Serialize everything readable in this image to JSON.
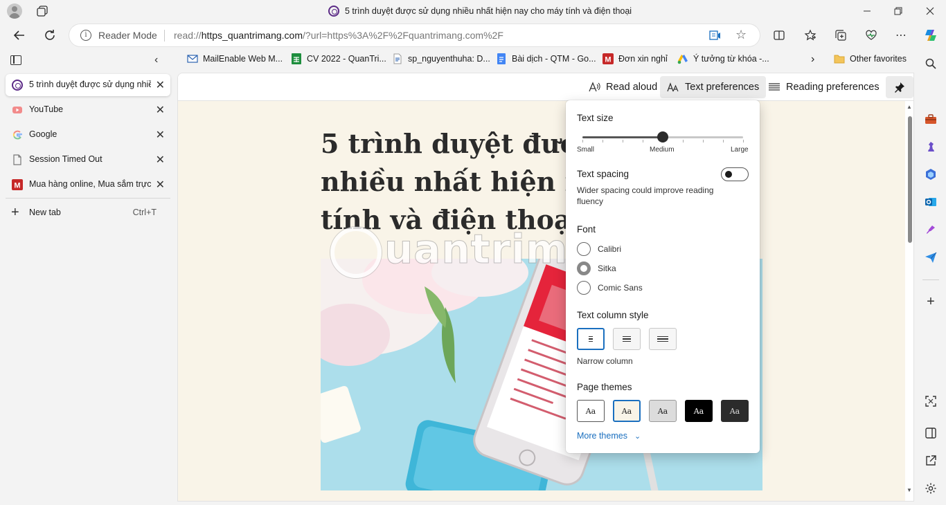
{
  "window": {
    "title": "5 trình duyệt được sử dụng nhiều nhất hiện nay cho máy tính và điện thoại",
    "minimize_icon": "minimize-icon",
    "maximize_icon": "restore-icon",
    "close_icon": "close-icon"
  },
  "address_bar": {
    "mode_label": "Reader Mode",
    "url_prefix": "read://",
    "url_host": "https_quantrimang.com",
    "url_rest": "/?url=https%3A%2F%2Fquantrimang.com%2F"
  },
  "bookmarks": [
    {
      "label": "MailEnable Web M...",
      "icon": "mail-icon"
    },
    {
      "label": "CV 2022 - QuanTri...",
      "icon": "sheets-icon"
    },
    {
      "label": "sp_nguyenthuha: D...",
      "icon": "doc-icon"
    },
    {
      "label": "Bài dịch - QTM - Go...",
      "icon": "gdocs-icon"
    },
    {
      "label": "Đơn xin nghỉ",
      "icon": "m-icon"
    },
    {
      "label": "Ý tưởng từ khóa -...",
      "icon": "ads-icon"
    }
  ],
  "other_favorites": "Other favorites",
  "tabs": [
    {
      "label": "5 trình duyệt được sử dụng nhiều",
      "active": true,
      "icon": "quantrimang-icon"
    },
    {
      "label": "YouTube",
      "active": false,
      "icon": "youtube-icon"
    },
    {
      "label": "Google",
      "active": false,
      "icon": "google-icon"
    },
    {
      "label": "Session Timed Out",
      "active": false,
      "icon": "page-icon"
    },
    {
      "label": "Mua hàng online, Mua sắm trực t",
      "active": false,
      "icon": "m-icon"
    }
  ],
  "new_tab": {
    "label": "New tab",
    "shortcut": "Ctrl+T"
  },
  "reader_toolbar": {
    "read_aloud": "Read aloud",
    "text_preferences": "Text preferences",
    "reading_preferences": "Reading preferences"
  },
  "article": {
    "title": "5 trình duyệt được sử dụng nhiều nhất hiện nay cho máy tính và điện thoại",
    "watermark": "uantrimang"
  },
  "text_prefs": {
    "text_size_heading": "Text size",
    "size_labels": {
      "small": "Small",
      "medium": "Medium",
      "large": "Large"
    },
    "size_level": 0.5,
    "text_spacing_heading": "Text spacing",
    "text_spacing_on": false,
    "text_spacing_desc": "Wider spacing could improve reading fluency",
    "font_heading": "Font",
    "fonts": [
      {
        "label": "Calibri",
        "checked": false
      },
      {
        "label": "Sitka",
        "checked": true
      },
      {
        "label": "Comic Sans",
        "checked": false
      }
    ],
    "column_heading": "Text column style",
    "column_selected_label": "Narrow column",
    "themes_heading": "Page themes",
    "theme_sample": "Aa",
    "themes": [
      {
        "bg": "#ffffff",
        "fg": "#1b1b1b",
        "border": "#555555"
      },
      {
        "bg": "#f9f4e8",
        "fg": "#1b1b1b",
        "border": "#1a6fbf"
      },
      {
        "bg": "#dcdcdc",
        "fg": "#1b1b1b",
        "border": "#999999"
      },
      {
        "bg": "#000000",
        "fg": "#ffffff",
        "border": "#000000"
      },
      {
        "bg": "#2b2b2b",
        "fg": "#dddddd",
        "border": "#2b2b2b"
      }
    ],
    "more_themes": "More themes"
  },
  "colors": {
    "accent": "#1a6fbf",
    "reader_bg": "#f9f4e8",
    "chrome_bg": "#f3f3f3"
  }
}
